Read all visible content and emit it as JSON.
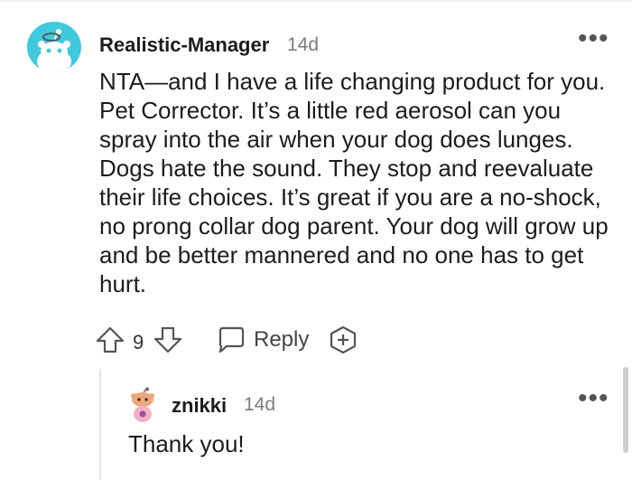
{
  "comment": {
    "username": "Realistic-Manager",
    "time": "14d",
    "text": "NTA—and I have a life changing product for you. Pet Corrector. It’s a little red aerosol can you spray into the air when your dog does lunges. Dogs hate the sound. They stop and reevaluate their life choices. It’s great if you are a no-shock, no prong collar dog parent. Your dog will grow up and be better mannered and no one has to get hurt.",
    "votes": "9",
    "reply_label": "Reply",
    "more_label": "•••",
    "icons": [
      "snoo-avatar-icon",
      "upvote-icon",
      "downvote-icon",
      "reply-bubble-icon",
      "award-icon",
      "more-options-icon"
    ],
    "avatar_color": "#3ec9dc"
  },
  "reply": {
    "username": "znikki",
    "time": "14d",
    "text": "Thank you!",
    "more_label": "•••",
    "icons": [
      "snoo-avatar-icon",
      "more-options-icon"
    ]
  }
}
